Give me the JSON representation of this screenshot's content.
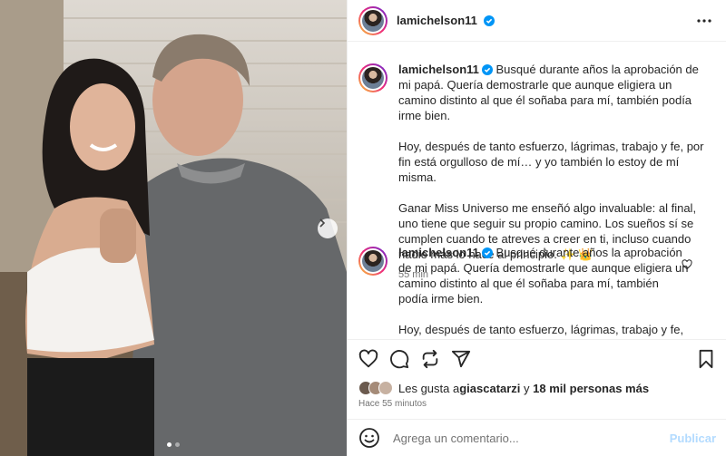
{
  "post": {
    "username": "lamichelson11",
    "verified": true,
    "photo_count": 2,
    "photo_index": 1
  },
  "comments": [
    {
      "username": "lamichelson11",
      "paragraphs": [
        "Busqué durante años la aprobación de mi papá. Quería demostrarle que aunque eligiera un camino distinto al que él soñaba para mí, también podía irme bien.",
        "Hoy, después de tanto esfuerzo, lágrimas, trabajo y fe, por fin está orgulloso de mí… y yo también lo estoy de mí misma.",
        "Ganar Miss Universo me enseñó algo invaluable: al final, uno tiene que seguir su propio camino. Los sueños sí se cumplen cuando te atreves a creer en ti, incluso cuando nadie más lo hace al principio. ✨ 👑"
      ],
      "time": "55 min"
    },
    {
      "username": "lamichelson11",
      "paragraphs": [
        "Busqué durante años la aprobación de mi papá. Quería demostrarle que aunque eligiera un camino distinto al que él soñaba para mí, también podía irme bien.",
        "Hoy, después de tanto esfuerzo, lágrimas, trabajo y fe, por fin está orgulloso de mí… y yo también lo estoy de mí misma."
      ]
    }
  ],
  "likes": {
    "prefix": "Les gusta a ",
    "user": "giascatarzi",
    "connector": " y ",
    "others": "18 mil personas más"
  },
  "posted_ago": "Hace 55 minutos",
  "add_comment": {
    "placeholder": "Agrega un comentario...",
    "publish_label": "Publicar"
  },
  "colors": {
    "verified": "#0095f6",
    "publish_disabled": "#b3dbff",
    "secondary_text": "#737373"
  }
}
